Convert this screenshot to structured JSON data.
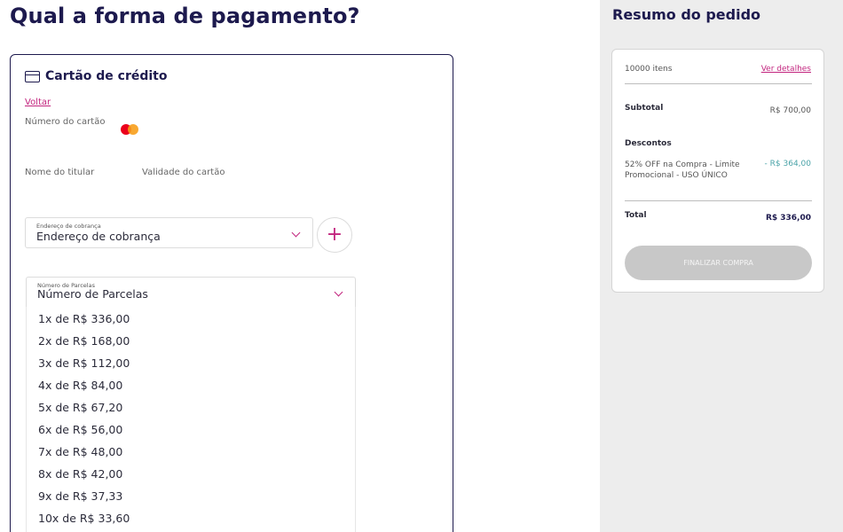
{
  "page": {
    "title": "Qual a forma de pagamento?"
  },
  "payment_card": {
    "icon": "credit-card-icon",
    "title": "Cartão de crédito",
    "back_label": "Voltar",
    "card_number_label": "Número do cartão",
    "brand_icon": "mastercard-icon",
    "holder_name_label": "Nome do titular",
    "expiry_label": "Validade do cartão",
    "billing_address": {
      "floating_label": "Endereço de cobrança",
      "value": "Endereço de cobrança",
      "add_button_label": "+"
    },
    "installments": {
      "floating_label": "Número de Parcelas",
      "value": "Número de Parcelas",
      "options": [
        "1x de R$ 336,00",
        "2x de R$ 168,00",
        "3x de R$ 112,00",
        "4x de R$ 84,00",
        "5x de R$ 67,20",
        "6x de R$ 56,00",
        "7x de R$ 48,00",
        "8x de R$ 42,00",
        "9x de R$ 37,33",
        "10x de R$ 33,60"
      ]
    }
  },
  "summary": {
    "title": "Resumo do pedido",
    "items_count": "10000 itens",
    "details_link": "Ver detalhes",
    "subtotal_label": "Subtotal",
    "subtotal_value": "R$ 700,00",
    "discounts_label": "Descontos",
    "discount_desc": "52% OFF na Compra - Limite Promocional - USO ÚNICO",
    "discount_value": "- R$ 364,00",
    "total_label": "Total",
    "total_value": "R$ 336,00",
    "finalize_label": "FINALIZAR COMPRA"
  },
  "colors": {
    "brand_navy": "#1d1a4e",
    "accent_pink": "#c2247e",
    "discount_teal": "#4aa3a8",
    "disabled_button": "#c8c8c8"
  }
}
